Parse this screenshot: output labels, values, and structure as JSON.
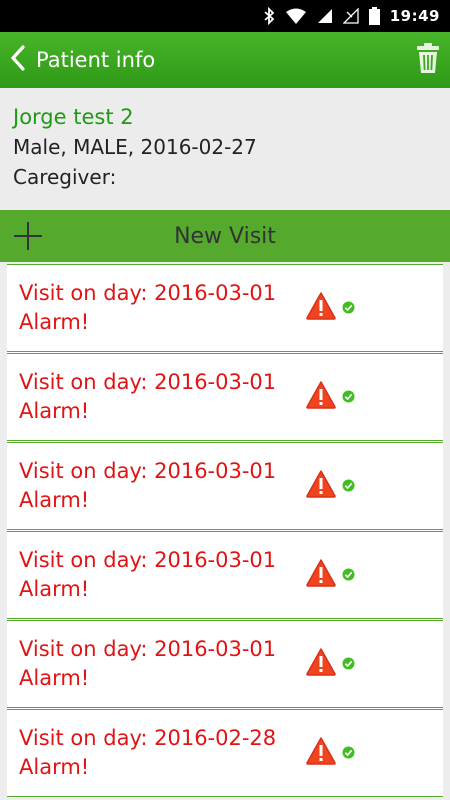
{
  "status_bar": {
    "time": "19:49",
    "icons": [
      "bluetooth-icon",
      "wifi-icon",
      "signal-icon",
      "no-signal-icon",
      "battery-icon"
    ]
  },
  "app_bar": {
    "title": "Patient info",
    "back_icon": "chevron-left-icon",
    "action_icon": "trash-icon"
  },
  "patient": {
    "name": "Jorge test 2",
    "details": "Male, MALE, 2016-02-27",
    "caregiver": "Caregiver:"
  },
  "new_visit": {
    "label": "New Visit",
    "icon": "plus-icon"
  },
  "visits": [
    {
      "title": "Visit on day: 2016-03-01",
      "status": "Alarm!"
    },
    {
      "title": "Visit on day: 2016-03-01",
      "status": "Alarm!"
    },
    {
      "title": "Visit on day: 2016-03-01",
      "status": "Alarm!"
    },
    {
      "title": "Visit on day: 2016-03-01",
      "status": "Alarm!"
    },
    {
      "title": "Visit on day: 2016-03-01",
      "status": "Alarm!"
    },
    {
      "title": "Visit on day: 2016-02-28",
      "status": "Alarm!"
    }
  ],
  "colors": {
    "primary": "#3aa81e",
    "accent_green": "#55aa2e",
    "alarm_red": "#e01414",
    "name_green": "#1f9a16"
  }
}
